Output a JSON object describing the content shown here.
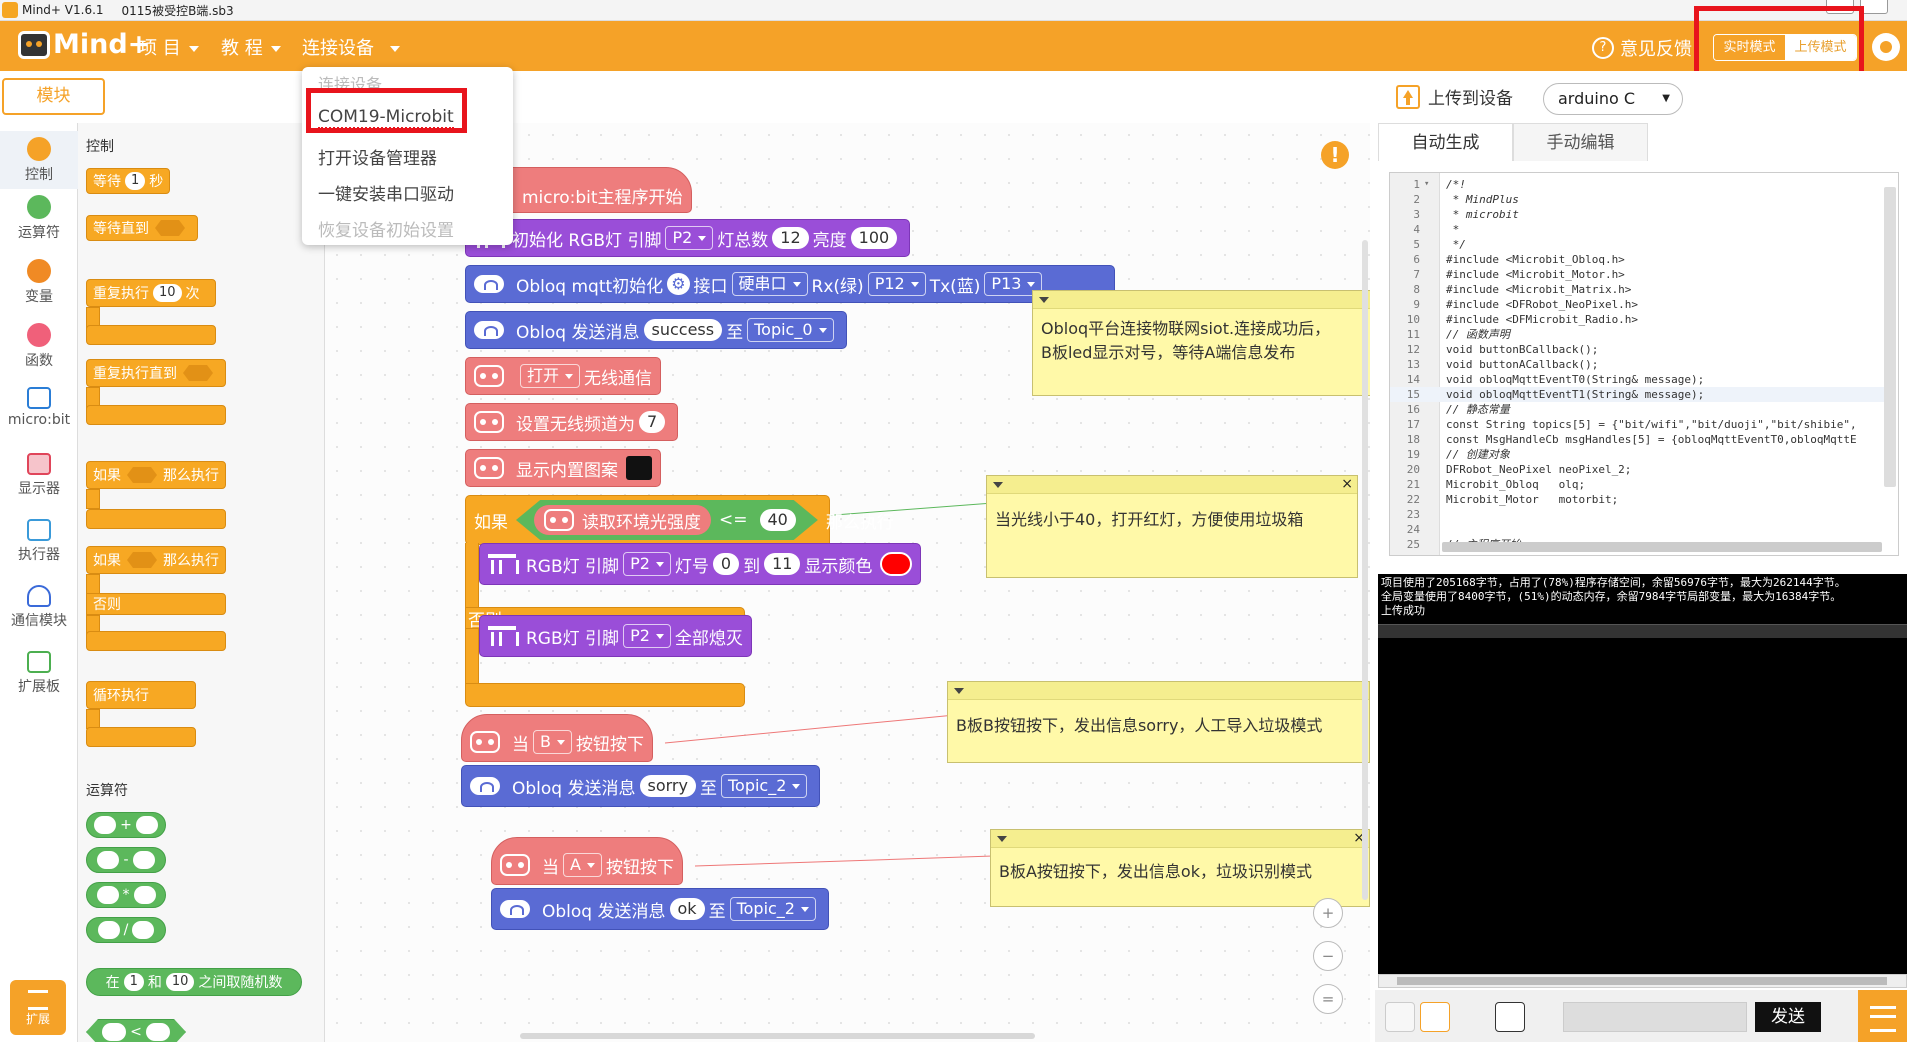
{
  "window": {
    "app_title": "Mind+ V1.6.1",
    "file_name": "0115被受控B端.sb3"
  },
  "menubar": {
    "logo_text": "Mind+",
    "items": [
      {
        "label": "项 目"
      },
      {
        "label": "教 程"
      },
      {
        "label": "连接设备"
      }
    ],
    "feedback": "意见反馈",
    "mode_realtime": "实时模式",
    "mode_upload": "上传模式"
  },
  "dropdown": {
    "items": [
      {
        "label": "连接设备",
        "disabled": true
      },
      {
        "label": "COM19-Microbit"
      },
      {
        "label": "打开设备管理器"
      },
      {
        "label": "一键安装串口驱动"
      },
      {
        "label": "恢复设备初始设置",
        "disabled": true
      }
    ]
  },
  "subbar": {
    "modules_tab": "模块",
    "upload_label": "上传到设备",
    "language_selected": "arduino C"
  },
  "categories": [
    {
      "label": "控制",
      "color": "#f5a228"
    },
    {
      "label": "运算符",
      "color": "#5cb85c"
    },
    {
      "label": "变量",
      "color": "#f08a24"
    },
    {
      "label": "函数",
      "color": "#f0607a"
    },
    {
      "label": "micro:bit",
      "color": "#2a7dd6"
    },
    {
      "label": "显示器",
      "color": "#e0455a"
    },
    {
      "label": "执行器",
      "color": "#3a9ad9"
    },
    {
      "label": "通信模块",
      "color": "#3a6ad9"
    },
    {
      "label": "扩展板",
      "color": "#4caf50"
    }
  ],
  "extension_button": "扩展",
  "palette": {
    "control_title": "控制",
    "wait": {
      "pre": "等待",
      "value": "1",
      "post": "秒"
    },
    "wait_until": "等待直到",
    "repeat": {
      "pre": "重复执行",
      "value": "10",
      "post": "次"
    },
    "repeat_until": "重复执行直到",
    "if_then": {
      "pre": "如果",
      "post": "那么执行"
    },
    "if_else": {
      "pre": "如果",
      "post": "那么执行",
      "else": "否则"
    },
    "forever": "循环执行",
    "operators_title": "运算符",
    "ops": [
      "+",
      "-",
      "*",
      "/"
    ],
    "random": {
      "pre": "在",
      "a": "1",
      "mid": "和",
      "b": "10",
      "post": "之间取随机数"
    },
    "compare_op": "<"
  },
  "workspace": {
    "main_hat": "micro:bit主程序开始",
    "init_rgb": {
      "pre": "初始化 RGB灯 引脚",
      "pin": "P2",
      "count_label": "灯总数",
      "count": "12",
      "bright_label": "亮度",
      "bright": "100"
    },
    "obloq_init": {
      "pre": "Obloq mqtt初始化",
      "port_label": "接口",
      "port": "硬串口",
      "rx_label": "Rx(绿)",
      "rx": "P12",
      "tx_label": "Tx(蓝)",
      "tx": "P13"
    },
    "obloq_send1": {
      "pre": "Obloq 发送消息",
      "msg": "success",
      "mid": "至",
      "topic": "Topic_0"
    },
    "radio_on": {
      "state": "打开",
      "post": "无线通信"
    },
    "radio_channel": {
      "pre": "设置无线频道为",
      "value": "7"
    },
    "show_icon": "显示内置图案",
    "if_block": {
      "if": "如果",
      "sensor": "读取环境光强度",
      "op": "<=",
      "value": "40",
      "then": "那么执行",
      "else": "否则"
    },
    "rgb_range": {
      "pre": "RGB灯 引脚",
      "pin": "P2",
      "num_label": "灯号",
      "from": "0",
      "to_label": "到",
      "to": "11",
      "color_label": "显示颜色"
    },
    "rgb_off": {
      "pre": "RGB灯 引脚",
      "pin": "P2",
      "post": "全部熄灭"
    },
    "when_b": {
      "pre": "当",
      "btn": "B",
      "post": "按钮按下"
    },
    "send_b": {
      "pre": "Obloq 发送消息",
      "msg": "sorry",
      "mid": "至",
      "topic": "Topic_2"
    },
    "when_a": {
      "pre": "当",
      "btn": "A",
      "post": "按钮按下"
    },
    "send_a": {
      "pre": "Obloq 发送消息",
      "msg": "ok",
      "mid": "至",
      "topic": "Topic_2"
    },
    "notes": [
      {
        "text1": "Obloq平台连接物联网siot.连接成功后，",
        "text2": "B板led显示对号，等待A端信息发布"
      },
      {
        "text1": "当光线小于40，打开红灯，方便使用垃圾箱"
      },
      {
        "text1": "B板B按钮按下，发出信息sorry，人工导入垃圾模式"
      },
      {
        "text1": "B板A按钮按下，发出信息ok，垃圾识别模式"
      }
    ],
    "warning_glyph": "!",
    "zoom_in": "+",
    "zoom_out": "−",
    "zoom_reset": "="
  },
  "code_tabs": {
    "auto": "自动生成",
    "manual": "手动编辑"
  },
  "code_lines": [
    "/*!",
    " * MindPlus",
    " * microbit",
    " *",
    " */",
    "#include <Microbit_Obloq.h>",
    "#include <Microbit_Motor.h>",
    "#include <Microbit_Matrix.h>",
    "#include <DFRobot_NeoPixel.h>",
    "#include <DFMicrobit_Radio.h>",
    "// 函数声明",
    "void buttonBCallback();",
    "void buttonACallback();",
    "void obloqMqttEventT0(String& message);",
    "void obloqMqttEventT1(String& message);",
    "// 静态常量",
    "const String topics[5] = {\"bit/wifi\",\"bit/duoji\",\"bit/shibie\",",
    "const MsgHandleCb msgHandles[5] = {obloqMqttEventT0,obloqMqttE",
    "// 创建对象",
    "DFRobot_NeoPixel neoPixel_2;",
    "Microbit_Obloq   olq;",
    "Microbit_Motor   motorbit;",
    "",
    "",
    "// 主程序开始"
  ],
  "console": {
    "line1": "项目使用了205168字节，占用了(78%)程序存储空间，余留56976字节，最大为262144字节。",
    "line2": "全局变量使用了8400字节，(51%)的动态内存，余留7984字节局部变量，最大为16384字节。",
    "line3": "上传成功"
  },
  "send_button": "发送",
  "colors": {
    "accent": "#f5a228",
    "highlight_red": "#e8141c"
  }
}
